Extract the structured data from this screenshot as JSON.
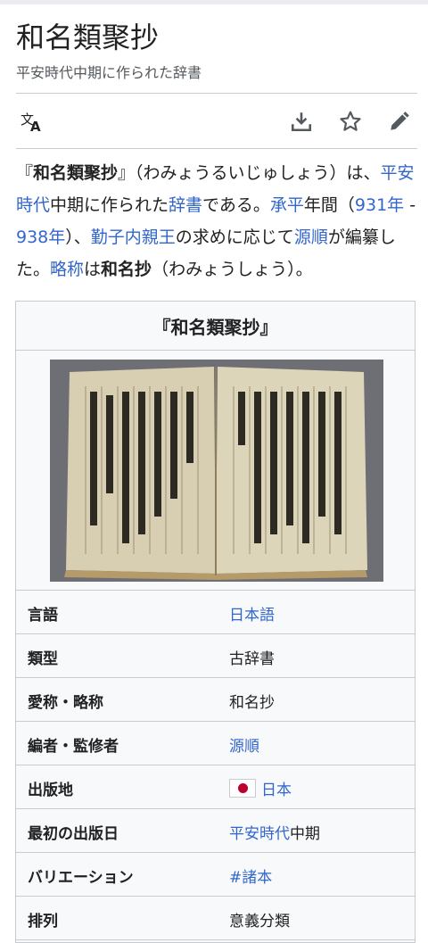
{
  "page": {
    "title": "和名類聚抄",
    "subtitle": "平安時代中期に作られた辞書"
  },
  "actions": [
    {
      "name": "language-icon",
      "symbol": "translate"
    },
    {
      "name": "download-icon",
      "symbol": "download"
    },
    {
      "name": "star-icon",
      "symbol": "watch"
    },
    {
      "name": "edit-icon",
      "symbol": "edit"
    }
  ],
  "lead": {
    "t1": "『",
    "b1": "和名類聚抄",
    "t2": "』（わみょうるいじゅしょう）は、",
    "l1": "平安時代",
    "t3": "中期に作られた",
    "l2": "辞書",
    "t4": "である。",
    "l3": "承平",
    "t5": "年間（",
    "l4": "931年",
    "t6": " - ",
    "l5": "938年",
    "t7": "）、",
    "l6": "勤子内親王",
    "t8": "の求めに応じて",
    "l7": "源順",
    "t9": "が編纂した。",
    "l8": "略称",
    "t10": "は",
    "b2": "和名抄",
    "t11": "（わみょうしょう）。"
  },
  "infobox": {
    "title": "『和名類聚抄』",
    "rows": [
      {
        "label": "言語",
        "value": "日本語",
        "link": true
      },
      {
        "label": "類型",
        "value": "古辞書",
        "link": false
      },
      {
        "label": "愛称・略称",
        "value": "和名抄",
        "link": false
      },
      {
        "label": "編者・監修者",
        "value": "源順",
        "link": true
      },
      {
        "label": "出版地",
        "value": "日本",
        "link": true,
        "flag": "japan-flag"
      },
      {
        "label": "最初の出版日",
        "value_link": "平安時代",
        "value_text": "中期"
      },
      {
        "label": "バリエーション",
        "value": "#諸本",
        "link": true
      },
      {
        "label": "排列",
        "value": "意義分類",
        "link": false
      }
    ]
  },
  "colors": {
    "link": "#3366cc",
    "text": "#202122",
    "border": "#c8ccd1",
    "infobox_bg": "#f8f9fa",
    "flag_red": "#bc002d"
  }
}
